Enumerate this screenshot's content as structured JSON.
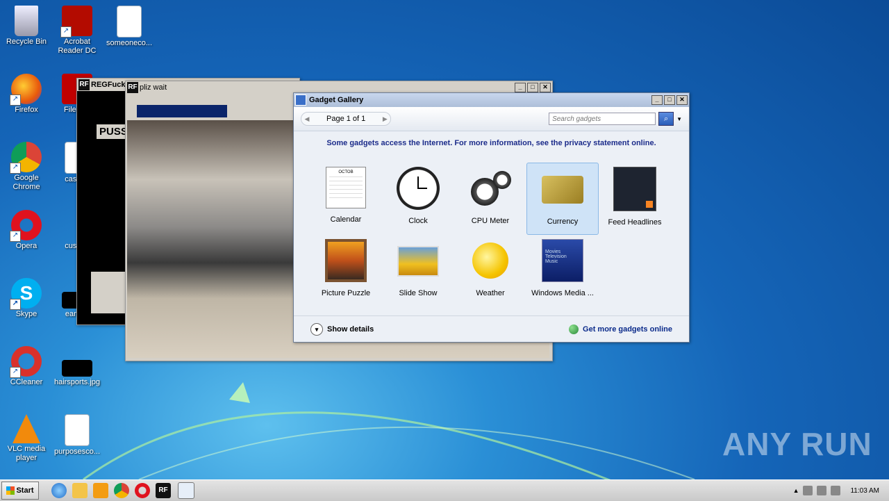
{
  "desktop": {
    "icons": [
      {
        "label": "Recycle Bin"
      },
      {
        "label": "Acrobat Reader DC"
      },
      {
        "label": "someoneco..."
      },
      {
        "label": "Firefox"
      },
      {
        "label": "FileZilla"
      },
      {
        "label": "Google Chrome"
      },
      {
        "label": "caseab"
      },
      {
        "label": "Opera"
      },
      {
        "label": "custom"
      },
      {
        "label": "Skype"
      },
      {
        "label": "earthm"
      },
      {
        "label": "CCleaner"
      },
      {
        "label": "hairsports.jpg"
      },
      {
        "label": "VLC media player"
      },
      {
        "label": "purposesco..."
      }
    ]
  },
  "windows": {
    "regfuck": {
      "title": "REGFuck",
      "body_text": "PUSS"
    },
    "pliz": {
      "title": "pliz wait"
    }
  },
  "gallery": {
    "title": "Gadget Gallery",
    "pager": "Page 1 of 1",
    "search_placeholder": "Search gadgets",
    "notice": "Some gadgets access the Internet.  For more information, see the privacy statement online.",
    "gadgets": [
      {
        "label": "Calendar",
        "icon": "calendar-icon"
      },
      {
        "label": "Clock",
        "icon": "clock-icon"
      },
      {
        "label": "CPU Meter",
        "icon": "cpu-meter-icon"
      },
      {
        "label": "Currency",
        "icon": "currency-icon",
        "selected": true
      },
      {
        "label": "Feed Headlines",
        "icon": "feed-icon"
      },
      {
        "label": "Picture Puzzle",
        "icon": "puzzle-icon"
      },
      {
        "label": "Slide Show",
        "icon": "slideshow-icon"
      },
      {
        "label": "Weather",
        "icon": "weather-icon"
      },
      {
        "label": "Windows Media ...",
        "icon": "media-center-icon"
      }
    ],
    "calendar_month": "OCTOB",
    "media_lines": [
      "Movies",
      "Television",
      "Music"
    ],
    "show_details": "Show details",
    "get_more": "Get more gadgets online"
  },
  "taskbar": {
    "start_label": "Start",
    "clock": "11:03 AM"
  },
  "watermark": "ANY RUN",
  "colors": {
    "accent": "#1b2b8a",
    "selection": "#cfe3f7"
  }
}
